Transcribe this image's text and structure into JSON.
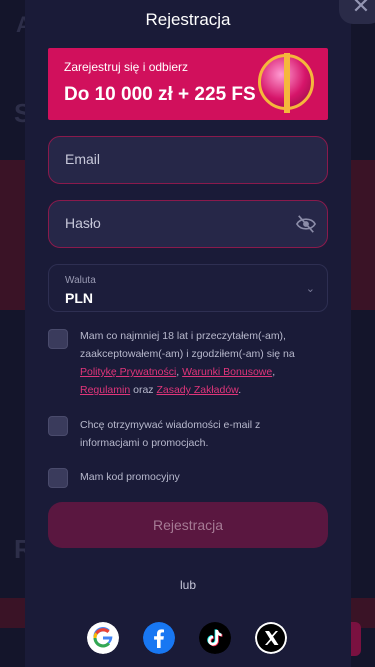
{
  "modal": {
    "title": "Rejestracja",
    "close_label": "✕"
  },
  "promo": {
    "subtitle": "Zarejestruj się i odbierz",
    "headline": "Do 10 000 zł + 225 FS"
  },
  "form": {
    "email_label": "Email",
    "password_label": "Hasło",
    "currency_label": "Waluta",
    "currency_value": "PLN"
  },
  "consents": {
    "age_text_1": "Mam co najmniej 18 lat i przeczytałem(-am), zaakceptowałem(-am) i zgodziłem(-am) się na ",
    "privacy_link": "Politykę Prywatności",
    "comma": ", ",
    "bonus_link": "Warunki Bonusowe",
    "comma2": ", ",
    "rules_link": "Regulamin",
    "and": " oraz ",
    "betting_link": "Zasady Zakładów",
    "dot": ".",
    "marketing_text": "Chcę otrzymywać wiadomości e-mail z informacjami o promocjach.",
    "promo_code_text": "Mam kod promocyjny"
  },
  "submit_label": "Rejestracja",
  "or_label": "lub",
  "social": [
    "google-icon",
    "facebook-icon",
    "tiktok-icon",
    "x-icon"
  ],
  "colors": {
    "accent": "#d1105c",
    "modal_bg": "#1a1b38",
    "field_bg": "#262748"
  }
}
